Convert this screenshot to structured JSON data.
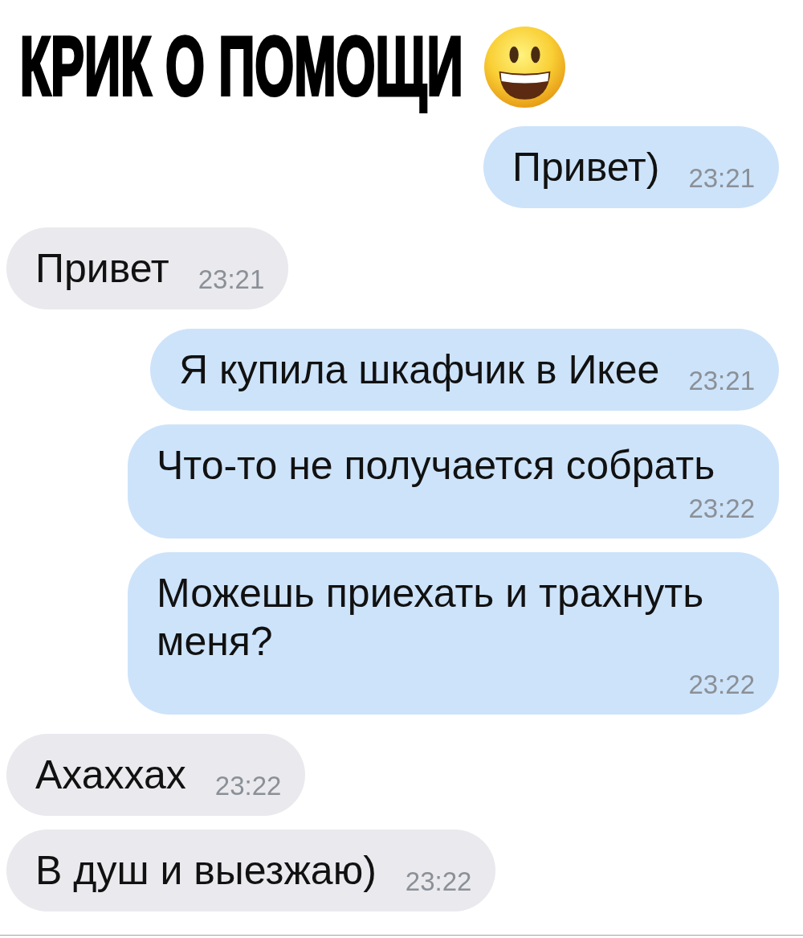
{
  "title": "КРИК О ПОМОЩИ",
  "messages": [
    {
      "kind": "outgoing",
      "text": "Привет)",
      "time": "23:21"
    },
    {
      "kind": "incoming",
      "text": "Привет",
      "time": "23:21"
    },
    {
      "kind": "outgoing",
      "text": "Я купила шкафчик в Икее",
      "time": "23:21"
    },
    {
      "kind": "outgoing",
      "text": "Что-то не получается собрать",
      "time": "23:22"
    },
    {
      "kind": "outgoing",
      "text": "Можешь приехать и трахнуть меня?",
      "time": "23:22"
    },
    {
      "kind": "incoming",
      "text": "Ахаххах",
      "time": "23:22"
    },
    {
      "kind": "incoming",
      "text": "В душ и выезжаю)",
      "time": "23:22"
    }
  ]
}
